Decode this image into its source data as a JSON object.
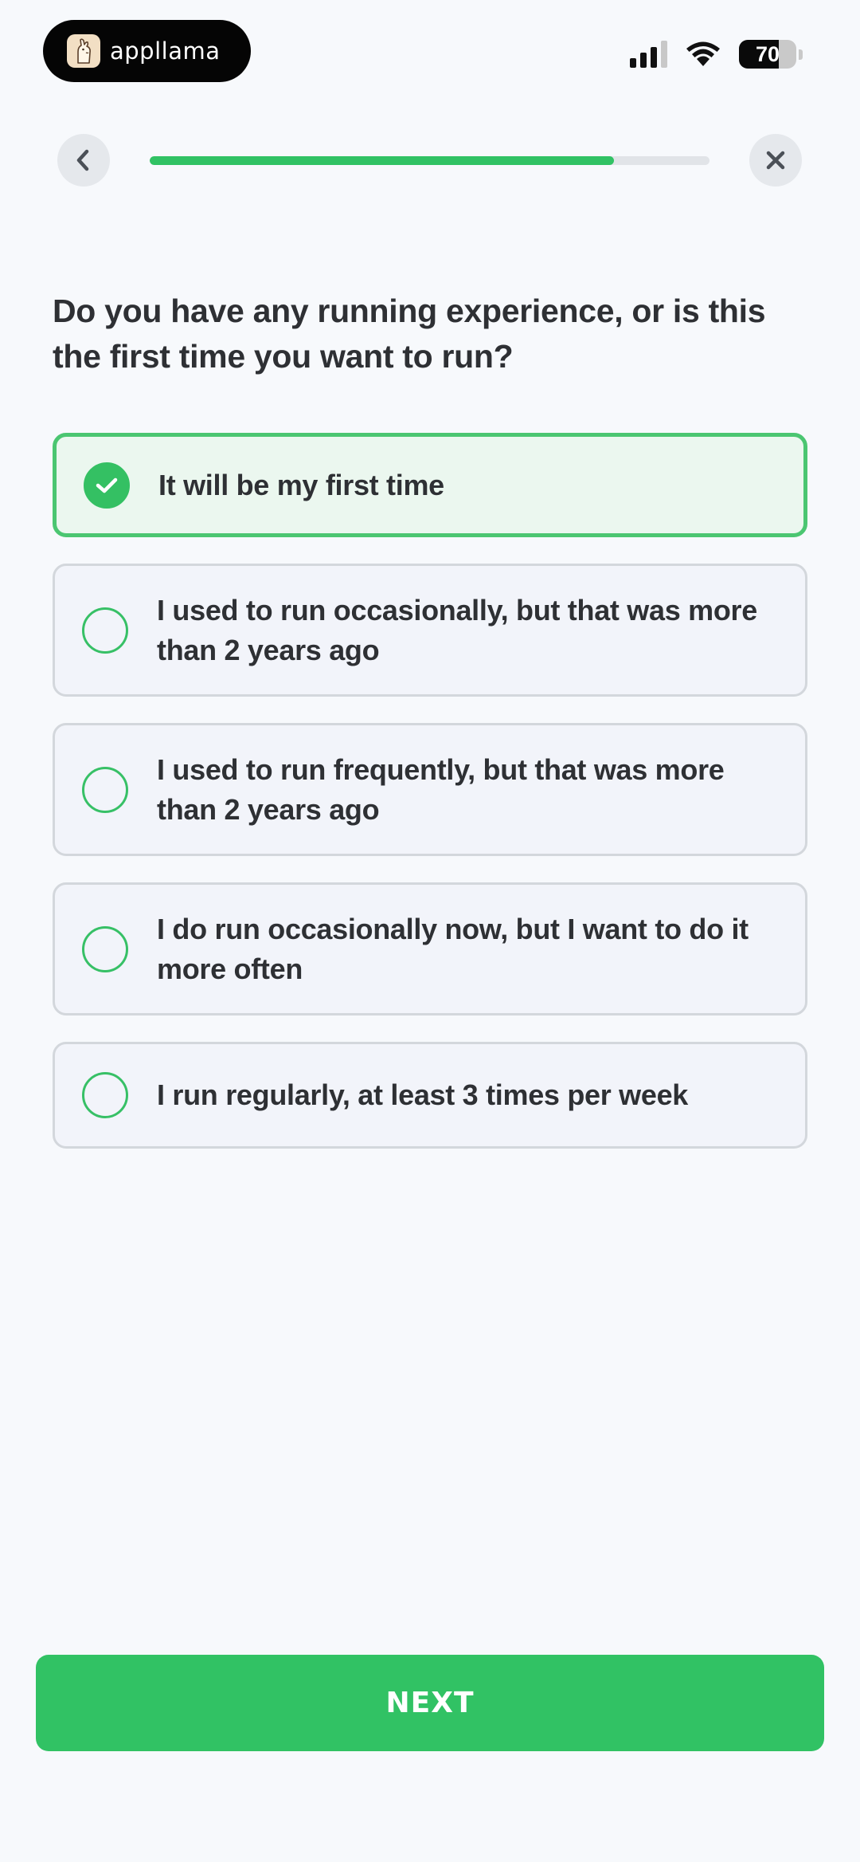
{
  "status_bar": {
    "brand_name": "appllama",
    "battery_level": "70",
    "battery_fraction": 0.7
  },
  "nav": {
    "back_icon": "chevron-left-icon",
    "close_icon": "close-icon",
    "progress_fraction": 0.83
  },
  "question": {
    "text": "Do you have any running experience, or is this the first time you want to run?"
  },
  "options": [
    {
      "label": "It will be my first time",
      "selected": true
    },
    {
      "label": "I used to run occasionally, but that was more than 2 years ago",
      "selected": false
    },
    {
      "label": "I used to run frequently, but that was more than 2 years ago",
      "selected": false
    },
    {
      "label": "I do run occasionally now, but I want to do it more often",
      "selected": false
    },
    {
      "label": "I run regularly, at least 3 times per week",
      "selected": false
    }
  ],
  "footer": {
    "next_label": "NEXT"
  },
  "colors": {
    "accent": "#31c264",
    "selected_bg": "#ebf7ef",
    "option_bg": "#f2f4fa",
    "page_bg": "#f7f9fc"
  }
}
